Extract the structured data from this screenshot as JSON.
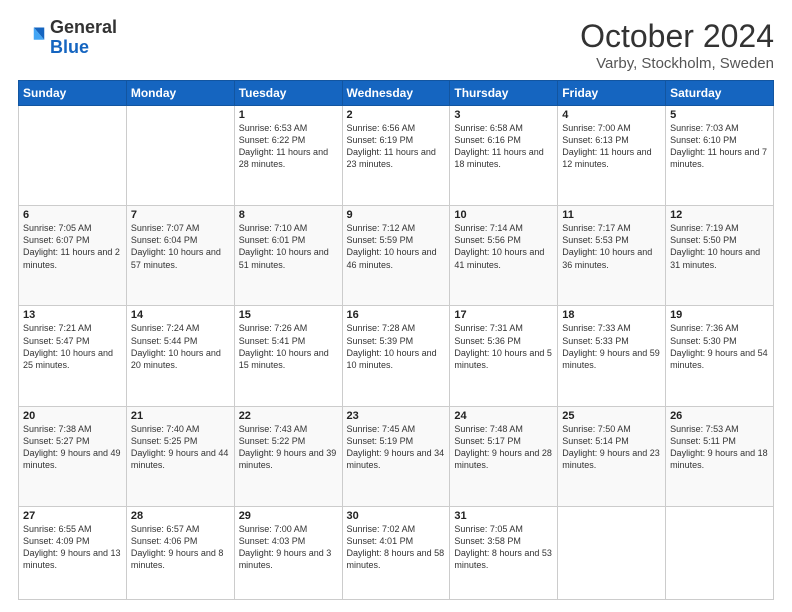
{
  "header": {
    "logo_general": "General",
    "logo_blue": "Blue",
    "month": "October 2024",
    "location": "Varby, Stockholm, Sweden"
  },
  "weekdays": [
    "Sunday",
    "Monday",
    "Tuesday",
    "Wednesday",
    "Thursday",
    "Friday",
    "Saturday"
  ],
  "weeks": [
    [
      {
        "day": "",
        "empty": true
      },
      {
        "day": "",
        "empty": true
      },
      {
        "day": "1",
        "sunrise": "Sunrise: 6:53 AM",
        "sunset": "Sunset: 6:22 PM",
        "daylight": "Daylight: 11 hours and 28 minutes."
      },
      {
        "day": "2",
        "sunrise": "Sunrise: 6:56 AM",
        "sunset": "Sunset: 6:19 PM",
        "daylight": "Daylight: 11 hours and 23 minutes."
      },
      {
        "day": "3",
        "sunrise": "Sunrise: 6:58 AM",
        "sunset": "Sunset: 6:16 PM",
        "daylight": "Daylight: 11 hours and 18 minutes."
      },
      {
        "day": "4",
        "sunrise": "Sunrise: 7:00 AM",
        "sunset": "Sunset: 6:13 PM",
        "daylight": "Daylight: 11 hours and 12 minutes."
      },
      {
        "day": "5",
        "sunrise": "Sunrise: 7:03 AM",
        "sunset": "Sunset: 6:10 PM",
        "daylight": "Daylight: 11 hours and 7 minutes."
      }
    ],
    [
      {
        "day": "6",
        "sunrise": "Sunrise: 7:05 AM",
        "sunset": "Sunset: 6:07 PM",
        "daylight": "Daylight: 11 hours and 2 minutes."
      },
      {
        "day": "7",
        "sunrise": "Sunrise: 7:07 AM",
        "sunset": "Sunset: 6:04 PM",
        "daylight": "Daylight: 10 hours and 57 minutes."
      },
      {
        "day": "8",
        "sunrise": "Sunrise: 7:10 AM",
        "sunset": "Sunset: 6:01 PM",
        "daylight": "Daylight: 10 hours and 51 minutes."
      },
      {
        "day": "9",
        "sunrise": "Sunrise: 7:12 AM",
        "sunset": "Sunset: 5:59 PM",
        "daylight": "Daylight: 10 hours and 46 minutes."
      },
      {
        "day": "10",
        "sunrise": "Sunrise: 7:14 AM",
        "sunset": "Sunset: 5:56 PM",
        "daylight": "Daylight: 10 hours and 41 minutes."
      },
      {
        "day": "11",
        "sunrise": "Sunrise: 7:17 AM",
        "sunset": "Sunset: 5:53 PM",
        "daylight": "Daylight: 10 hours and 36 minutes."
      },
      {
        "day": "12",
        "sunrise": "Sunrise: 7:19 AM",
        "sunset": "Sunset: 5:50 PM",
        "daylight": "Daylight: 10 hours and 31 minutes."
      }
    ],
    [
      {
        "day": "13",
        "sunrise": "Sunrise: 7:21 AM",
        "sunset": "Sunset: 5:47 PM",
        "daylight": "Daylight: 10 hours and 25 minutes."
      },
      {
        "day": "14",
        "sunrise": "Sunrise: 7:24 AM",
        "sunset": "Sunset: 5:44 PM",
        "daylight": "Daylight: 10 hours and 20 minutes."
      },
      {
        "day": "15",
        "sunrise": "Sunrise: 7:26 AM",
        "sunset": "Sunset: 5:41 PM",
        "daylight": "Daylight: 10 hours and 15 minutes."
      },
      {
        "day": "16",
        "sunrise": "Sunrise: 7:28 AM",
        "sunset": "Sunset: 5:39 PM",
        "daylight": "Daylight: 10 hours and 10 minutes."
      },
      {
        "day": "17",
        "sunrise": "Sunrise: 7:31 AM",
        "sunset": "Sunset: 5:36 PM",
        "daylight": "Daylight: 10 hours and 5 minutes."
      },
      {
        "day": "18",
        "sunrise": "Sunrise: 7:33 AM",
        "sunset": "Sunset: 5:33 PM",
        "daylight": "Daylight: 9 hours and 59 minutes."
      },
      {
        "day": "19",
        "sunrise": "Sunrise: 7:36 AM",
        "sunset": "Sunset: 5:30 PM",
        "daylight": "Daylight: 9 hours and 54 minutes."
      }
    ],
    [
      {
        "day": "20",
        "sunrise": "Sunrise: 7:38 AM",
        "sunset": "Sunset: 5:27 PM",
        "daylight": "Daylight: 9 hours and 49 minutes."
      },
      {
        "day": "21",
        "sunrise": "Sunrise: 7:40 AM",
        "sunset": "Sunset: 5:25 PM",
        "daylight": "Daylight: 9 hours and 44 minutes."
      },
      {
        "day": "22",
        "sunrise": "Sunrise: 7:43 AM",
        "sunset": "Sunset: 5:22 PM",
        "daylight": "Daylight: 9 hours and 39 minutes."
      },
      {
        "day": "23",
        "sunrise": "Sunrise: 7:45 AM",
        "sunset": "Sunset: 5:19 PM",
        "daylight": "Daylight: 9 hours and 34 minutes."
      },
      {
        "day": "24",
        "sunrise": "Sunrise: 7:48 AM",
        "sunset": "Sunset: 5:17 PM",
        "daylight": "Daylight: 9 hours and 28 minutes."
      },
      {
        "day": "25",
        "sunrise": "Sunrise: 7:50 AM",
        "sunset": "Sunset: 5:14 PM",
        "daylight": "Daylight: 9 hours and 23 minutes."
      },
      {
        "day": "26",
        "sunrise": "Sunrise: 7:53 AM",
        "sunset": "Sunset: 5:11 PM",
        "daylight": "Daylight: 9 hours and 18 minutes."
      }
    ],
    [
      {
        "day": "27",
        "sunrise": "Sunrise: 6:55 AM",
        "sunset": "Sunset: 4:09 PM",
        "daylight": "Daylight: 9 hours and 13 minutes."
      },
      {
        "day": "28",
        "sunrise": "Sunrise: 6:57 AM",
        "sunset": "Sunset: 4:06 PM",
        "daylight": "Daylight: 9 hours and 8 minutes."
      },
      {
        "day": "29",
        "sunrise": "Sunrise: 7:00 AM",
        "sunset": "Sunset: 4:03 PM",
        "daylight": "Daylight: 9 hours and 3 minutes."
      },
      {
        "day": "30",
        "sunrise": "Sunrise: 7:02 AM",
        "sunset": "Sunset: 4:01 PM",
        "daylight": "Daylight: 8 hours and 58 minutes."
      },
      {
        "day": "31",
        "sunrise": "Sunrise: 7:05 AM",
        "sunset": "Sunset: 3:58 PM",
        "daylight": "Daylight: 8 hours and 53 minutes."
      },
      {
        "day": "",
        "empty": true
      },
      {
        "day": "",
        "empty": true
      }
    ]
  ]
}
